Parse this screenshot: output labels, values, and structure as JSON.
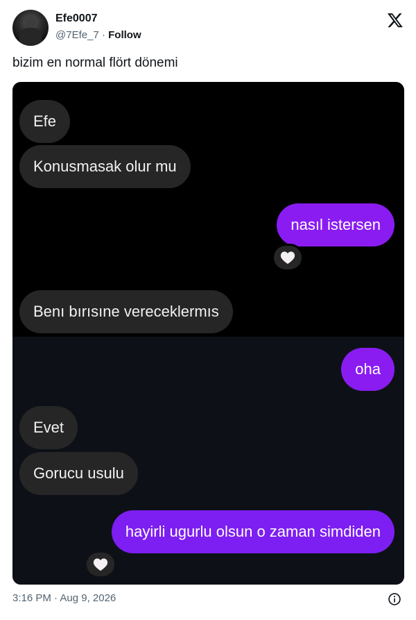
{
  "tweet": {
    "author_name": "Efe0007",
    "handle": "@7Efe_7",
    "separator": " · ",
    "follow_label": "Follow",
    "text": "bizim en normal flört dönemi",
    "timestamp": "3:16 PM · Aug 9, 2026",
    "icons": {
      "logo": "x-logo-icon",
      "info": "info-icon",
      "avatar": "avatar"
    }
  },
  "chat": {
    "messages": [
      {
        "text": "Efe",
        "direction": "incoming"
      },
      {
        "text": "Konusmasak olur mu",
        "direction": "incoming"
      },
      {
        "text": "nasıl istersen",
        "direction": "outgoing",
        "reaction": "white-heart-icon"
      },
      {
        "text": "Benı bırısıne vereceklermıs",
        "direction": "incoming"
      },
      {
        "text": "oha",
        "direction": "outgoing"
      },
      {
        "text": "Evet",
        "direction": "incoming"
      },
      {
        "text": "Gorucu usulu",
        "direction": "incoming"
      },
      {
        "text": "hayirli ugurlu olsun o zaman simdiden",
        "direction": "outgoing",
        "reaction": "white-heart-icon"
      }
    ],
    "colors": {
      "incoming_bubble": "#262626",
      "outgoing_bubble": "#8a1cf2",
      "background_top": "#000000",
      "background_bottom": "#0d1117"
    }
  }
}
